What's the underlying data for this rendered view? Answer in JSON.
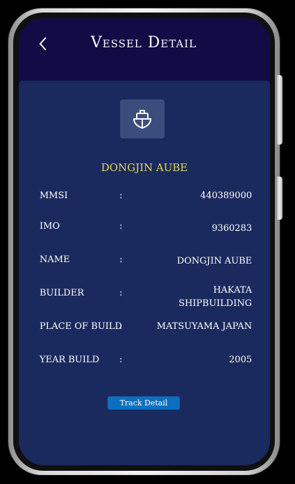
{
  "header": {
    "back_icon": "chevron-left-icon",
    "title": "Vessel Detail"
  },
  "vessel": {
    "icon": "ship-icon",
    "name": "DONGJIN AUBE"
  },
  "details": [
    {
      "label": "MMSI",
      "separator": ":",
      "value": "440389000"
    },
    {
      "label": "IMO",
      "separator": ":",
      "value": "9360283"
    },
    {
      "label": "NAME",
      "separator": ":",
      "value": "DONGJIN AUBE"
    },
    {
      "label": "BUILDER",
      "separator": ":",
      "value": "HAKATA SHIPBUILDING"
    },
    {
      "label": "PLACE OF BUILD",
      "separator": ":",
      "value": "MATSUYAMA JAPAN"
    },
    {
      "label": "YEAR BUILD",
      "separator": ":",
      "value": "2005"
    }
  ],
  "actions": {
    "track_label": "Track Detail"
  },
  "colors": {
    "header_bg": "#110c45",
    "panel_bg": "#1b2a5e",
    "vessel_name": "#e3d65a",
    "button_bg": "#0c6fc0"
  }
}
